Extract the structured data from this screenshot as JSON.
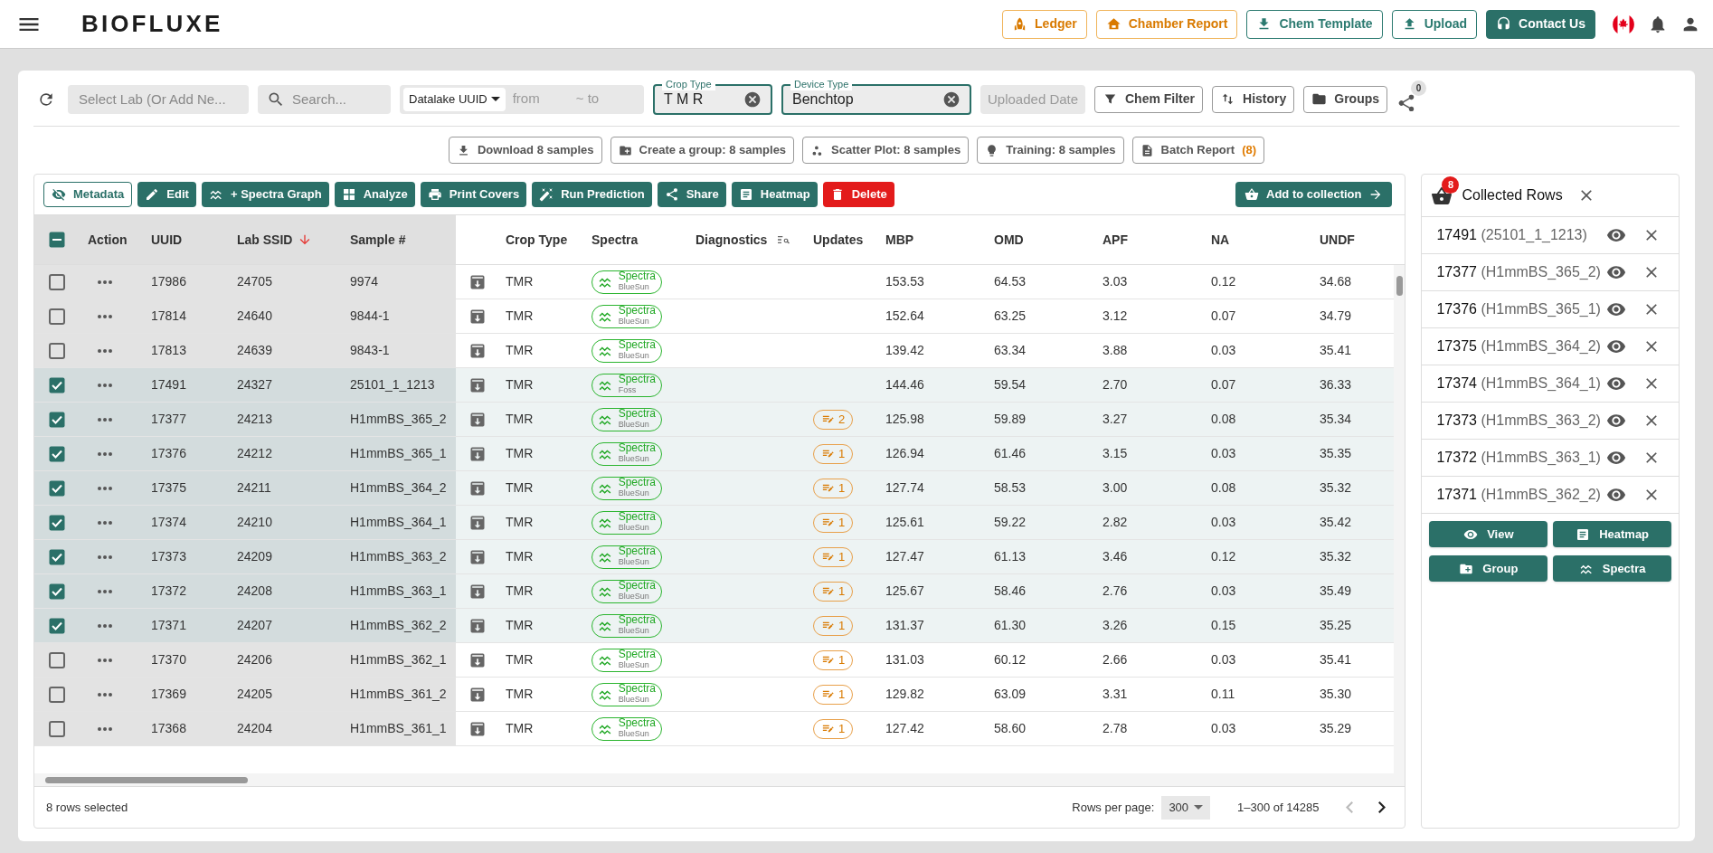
{
  "header": {
    "logo": "BIOFLUXE",
    "buttons": [
      {
        "label": "Ledger",
        "kind": "outline"
      },
      {
        "label": "Chamber Report",
        "kind": "outline"
      },
      {
        "label": "Chem Template",
        "kind": "outline-teal"
      },
      {
        "label": "Upload",
        "kind": "outline-teal"
      },
      {
        "label": "Contact Us",
        "kind": "primary"
      }
    ]
  },
  "filters": {
    "lab_select": {
      "placeholder": "Select Lab (Or Add Ne..."
    },
    "search": {
      "placeholder": "Search..."
    },
    "id_type": {
      "value": "Datalake UUID"
    },
    "from": {
      "placeholder": "from"
    },
    "to": {
      "placeholder": "~ to"
    },
    "crop_type": {
      "label": "Crop Type",
      "value": "T M R"
    },
    "device_type": {
      "label": "Device Type",
      "value": "Benchtop"
    },
    "uploaded_date": {
      "placeholder": "Uploaded Date"
    },
    "buttons": [
      "Chem Filter",
      "History",
      "Groups"
    ],
    "share_count": "0"
  },
  "bulk_actions": [
    {
      "label": "Download 8 samples"
    },
    {
      "label": "Create a group: 8 samples"
    },
    {
      "label": "Scatter Plot: 8 samples"
    },
    {
      "label": "Training: 8 samples"
    },
    {
      "label": "Batch Report",
      "count": "(8)"
    }
  ],
  "toolbar": {
    "buttons": [
      {
        "label": "Metadata",
        "kind": "outline"
      },
      {
        "label": "Edit",
        "kind": "primary"
      },
      {
        "label": "+ Spectra Graph",
        "kind": "primary"
      },
      {
        "label": "Analyze",
        "kind": "primary"
      },
      {
        "label": "Print Covers",
        "kind": "primary"
      },
      {
        "label": "Run Prediction",
        "kind": "primary"
      },
      {
        "label": "Share",
        "kind": "primary"
      },
      {
        "label": "Heatmap",
        "kind": "primary"
      },
      {
        "label": "Delete",
        "kind": "danger"
      }
    ],
    "collect_button": "Add to collection"
  },
  "table": {
    "select_all": {
      "indeterminate": true
    },
    "columns": [
      {
        "label": "Action",
        "sorted": false,
        "filter": false
      },
      {
        "label": "UUID",
        "sorted": false,
        "filter": false
      },
      {
        "label": "Lab SSID",
        "sorted": true,
        "filter": false
      },
      {
        "label": "Sample #",
        "sorted": false,
        "filter": false
      },
      {
        "label": "Crop Type",
        "sorted": false,
        "filter": false
      },
      {
        "label": "Spectra",
        "sorted": false,
        "filter": false
      },
      {
        "label": "Diagnostics",
        "sorted": false,
        "filter": true
      },
      {
        "label": "Updates",
        "sorted": false,
        "filter": false
      },
      {
        "label": "MBP",
        "sorted": false,
        "filter": false
      },
      {
        "label": "OMD",
        "sorted": false,
        "filter": false
      },
      {
        "label": "APF",
        "sorted": false,
        "filter": false
      },
      {
        "label": "NA",
        "sorted": false,
        "filter": false
      },
      {
        "label": "UNDF",
        "sorted": false,
        "filter": false
      }
    ],
    "rows": [
      {
        "selected": false,
        "uuid": "17986",
        "lab_ssid": "24705",
        "sample": "9974",
        "crop_type": "TMR",
        "spectra": "Spectra",
        "source": "BlueSun",
        "mbp": "153.53",
        "omd": "64.53",
        "apf": "3.03",
        "na": "0.12",
        "undf": "34.68"
      },
      {
        "selected": false,
        "uuid": "17814",
        "lab_ssid": "24640",
        "sample": "9844-1",
        "crop_type": "TMR",
        "spectra": "Spectra",
        "source": "BlueSun",
        "mbp": "152.64",
        "omd": "63.25",
        "apf": "3.12",
        "na": "0.07",
        "undf": "34.79"
      },
      {
        "selected": false,
        "uuid": "17813",
        "lab_ssid": "24639",
        "sample": "9843-1",
        "crop_type": "TMR",
        "spectra": "Spectra",
        "source": "BlueSun",
        "mbp": "139.42",
        "omd": "63.34",
        "apf": "3.88",
        "na": "0.03",
        "undf": "35.41"
      },
      {
        "selected": true,
        "uuid": "17491",
        "lab_ssid": "24327",
        "sample": "25101_1_1213",
        "crop_type": "TMR",
        "spectra": "Spectra",
        "source": "Foss",
        "mbp": "144.46",
        "omd": "59.54",
        "apf": "2.70",
        "na": "0.07",
        "undf": "36.33"
      },
      {
        "selected": true,
        "uuid": "17377",
        "lab_ssid": "24213",
        "sample": "H1mmBS_365_2",
        "crop_type": "TMR",
        "spectra": "Spectra",
        "source": "BlueSun",
        "updates": "2",
        "mbp": "125.98",
        "omd": "59.89",
        "apf": "3.27",
        "na": "0.08",
        "undf": "35.34"
      },
      {
        "selected": true,
        "uuid": "17376",
        "lab_ssid": "24212",
        "sample": "H1mmBS_365_1",
        "crop_type": "TMR",
        "spectra": "Spectra",
        "source": "BlueSun",
        "updates": "1",
        "mbp": "126.94",
        "omd": "61.46",
        "apf": "3.15",
        "na": "0.03",
        "undf": "35.35"
      },
      {
        "selected": true,
        "uuid": "17375",
        "lab_ssid": "24211",
        "sample": "H1mmBS_364_2",
        "crop_type": "TMR",
        "spectra": "Spectra",
        "source": "BlueSun",
        "updates": "1",
        "mbp": "127.74",
        "omd": "58.53",
        "apf": "3.00",
        "na": "0.08",
        "undf": "35.32"
      },
      {
        "selected": true,
        "uuid": "17374",
        "lab_ssid": "24210",
        "sample": "H1mmBS_364_1",
        "crop_type": "TMR",
        "spectra": "Spectra",
        "source": "BlueSun",
        "updates": "1",
        "mbp": "125.61",
        "omd": "59.22",
        "apf": "2.82",
        "na": "0.03",
        "undf": "35.42"
      },
      {
        "selected": true,
        "uuid": "17373",
        "lab_ssid": "24209",
        "sample": "H1mmBS_363_2",
        "crop_type": "TMR",
        "spectra": "Spectra",
        "source": "BlueSun",
        "updates": "1",
        "mbp": "127.47",
        "omd": "61.13",
        "apf": "3.46",
        "na": "0.12",
        "undf": "35.32"
      },
      {
        "selected": true,
        "uuid": "17372",
        "lab_ssid": "24208",
        "sample": "H1mmBS_363_1",
        "crop_type": "TMR",
        "spectra": "Spectra",
        "source": "BlueSun",
        "updates": "1",
        "mbp": "125.67",
        "omd": "58.46",
        "apf": "2.76",
        "na": "0.03",
        "undf": "35.49"
      },
      {
        "selected": true,
        "uuid": "17371",
        "lab_ssid": "24207",
        "sample": "H1mmBS_362_2",
        "crop_type": "TMR",
        "spectra": "Spectra",
        "source": "BlueSun",
        "updates": "1",
        "mbp": "131.37",
        "omd": "61.30",
        "apf": "3.26",
        "na": "0.15",
        "undf": "35.25"
      },
      {
        "selected": false,
        "uuid": "17370",
        "lab_ssid": "24206",
        "sample": "H1mmBS_362_1",
        "crop_type": "TMR",
        "spectra": "Spectra",
        "source": "BlueSun",
        "updates": "1",
        "mbp": "131.03",
        "omd": "60.12",
        "apf": "2.66",
        "na": "0.03",
        "undf": "35.41"
      },
      {
        "selected": false,
        "uuid": "17369",
        "lab_ssid": "24205",
        "sample": "H1mmBS_361_2",
        "crop_type": "TMR",
        "spectra": "Spectra",
        "source": "BlueSun",
        "updates": "1",
        "mbp": "129.82",
        "omd": "63.09",
        "apf": "3.31",
        "na": "0.11",
        "undf": "35.30"
      },
      {
        "selected": false,
        "uuid": "17368",
        "lab_ssid": "24204",
        "sample": "H1mmBS_361_1",
        "crop_type": "TMR",
        "spectra": "Spectra",
        "source": "BlueSun",
        "updates": "1",
        "mbp": "127.42",
        "omd": "58.60",
        "apf": "2.78",
        "na": "0.03",
        "undf": "35.29"
      }
    ]
  },
  "footer": {
    "selected_text": "8 rows selected",
    "rows_per_page_label": "Rows per page:",
    "rows_per_page": "300",
    "range": "1–300 of 14285",
    "prev_disabled": true,
    "next_disabled": false
  },
  "collected": {
    "count": "8",
    "title": "Collected Rows",
    "items": [
      {
        "uuid": "17491",
        "sample": "(25101_1_1213)"
      },
      {
        "uuid": "17377",
        "sample": "(H1mmBS_365_2)"
      },
      {
        "uuid": "17376",
        "sample": "(H1mmBS_365_1)"
      },
      {
        "uuid": "17375",
        "sample": "(H1mmBS_364_2)"
      },
      {
        "uuid": "17374",
        "sample": "(H1mmBS_364_1)"
      },
      {
        "uuid": "17373",
        "sample": "(H1mmBS_363_2)"
      },
      {
        "uuid": "17372",
        "sample": "(H1mmBS_363_1)"
      },
      {
        "uuid": "17371",
        "sample": "(H1mmBS_362_2)"
      }
    ],
    "buttons": [
      "View",
      "Heatmap",
      "Group",
      "Spectra"
    ]
  }
}
